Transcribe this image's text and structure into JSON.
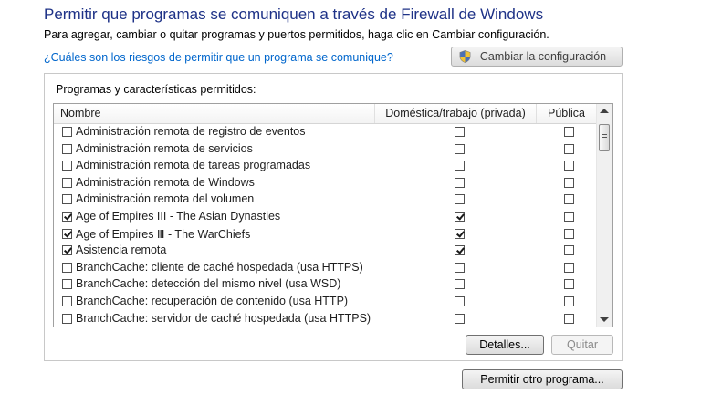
{
  "header": {
    "title": "Permitir que programas se comuniquen a través de Firewall de Windows",
    "subtitle": "Para agregar, cambiar o quitar programas y puertos permitidos, haga clic en Cambiar configuración.",
    "risk_link": "¿Cuáles son los riesgos de permitir que un programa se comunique?",
    "change_settings_label": "Cambiar la configuración",
    "change_settings_icon": "uac-shield-icon"
  },
  "panel": {
    "label": "Programas y características permitidos:",
    "columns": {
      "name": "Nombre",
      "private": "Doméstica/trabajo (privada)",
      "public": "Pública"
    },
    "rows": [
      {
        "name": "Administración remota de registro de eventos",
        "enabled": false,
        "private": false,
        "public": false
      },
      {
        "name": "Administración remota de servicios",
        "enabled": false,
        "private": false,
        "public": false
      },
      {
        "name": "Administración remota de tareas programadas",
        "enabled": false,
        "private": false,
        "public": false
      },
      {
        "name": "Administración remota de Windows",
        "enabled": false,
        "private": false,
        "public": false
      },
      {
        "name": "Administración remota del volumen",
        "enabled": false,
        "private": false,
        "public": false
      },
      {
        "name": "Age of Empires III - The Asian Dynasties",
        "enabled": true,
        "private": true,
        "public": false
      },
      {
        "name": "Age of Empires Ⅲ - The WarChiefs",
        "enabled": true,
        "private": true,
        "public": false
      },
      {
        "name": "Asistencia remota",
        "enabled": true,
        "private": true,
        "public": false
      },
      {
        "name": "BranchCache: cliente de caché hospedada (usa HTTPS)",
        "enabled": false,
        "private": false,
        "public": false
      },
      {
        "name": "BranchCache: detección del mismo nivel (usa WSD)",
        "enabled": false,
        "private": false,
        "public": false
      },
      {
        "name": "BranchCache: recuperación de contenido (usa HTTP)",
        "enabled": false,
        "private": false,
        "public": false
      },
      {
        "name": "BranchCache: servidor de caché hospedada (usa HTTPS)",
        "enabled": false,
        "private": false,
        "public": false
      }
    ],
    "details_label": "Detalles...",
    "remove_label": "Quitar"
  },
  "allow_other_label": "Permitir otro programa..."
}
